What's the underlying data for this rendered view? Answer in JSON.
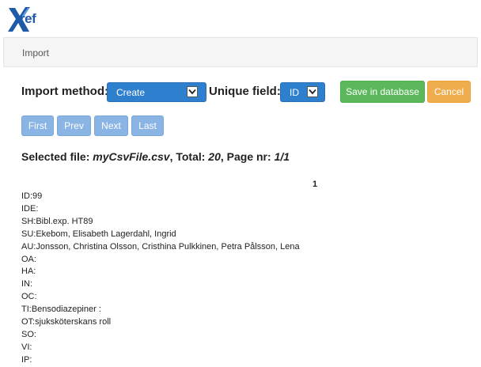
{
  "app": {
    "logo_text": "ref",
    "logo_mark": "X",
    "brand_color": "#1f5aa8"
  },
  "breadcrumb": {
    "current": "Import"
  },
  "form": {
    "import_method_label": "Import method:",
    "import_method_value": "Create",
    "unique_field_label": "Unique field:",
    "unique_field_value": "ID",
    "save_label": "Save in database",
    "cancel_label": "Cancel"
  },
  "pager": {
    "first": "First",
    "prev": "Prev",
    "next": "Next",
    "last": "Last"
  },
  "summary": {
    "prefix": "Selected file: ",
    "file_name": "myCsvFile.csv",
    "total_label": ", Total: ",
    "total": "20",
    "page_label": ", Page nr: ",
    "page": "1/1"
  },
  "record": {
    "column_number": "1",
    "fields": [
      "ID:99",
      "IDE:",
      "SH:Bibl.exp. HT89",
      "SU:Ekebom, Elisabeth Lagerdahl, Ingrid",
      "AU:Jonsson, Christina Olsson, Cristhina Pulkkinen, Petra Pålsson, Lena",
      "OA:",
      "HA:",
      "IN:",
      "OC:",
      "TI:Bensodiazepiner :",
      "OT:sjuksköterskans roll",
      "SO:",
      "VI:",
      "IP:"
    ]
  }
}
